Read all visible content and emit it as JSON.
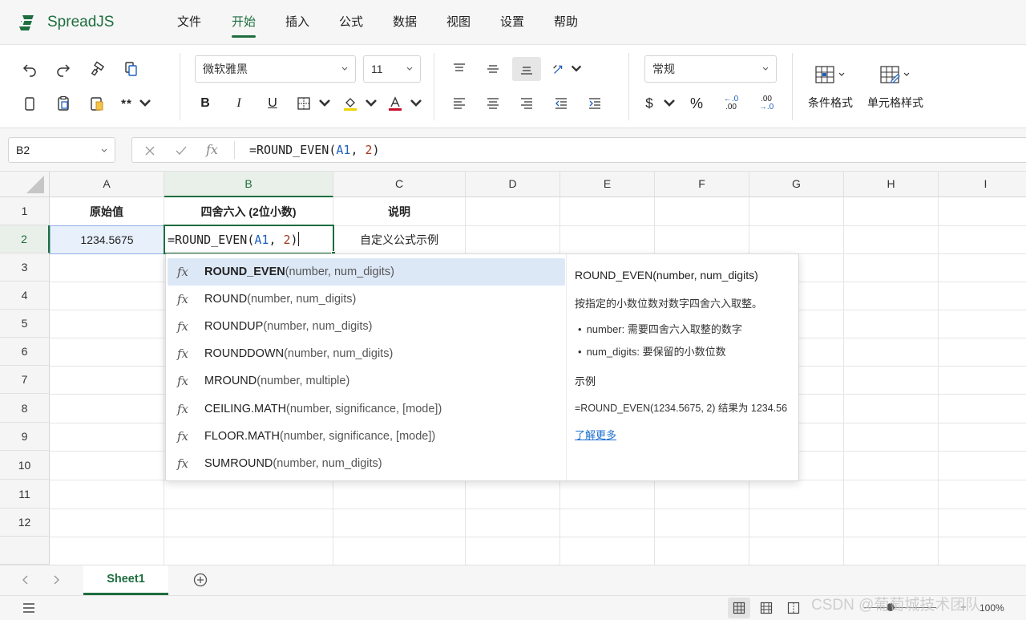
{
  "app": {
    "name": "SpreadJS",
    "logo_icon": "spreadjs-logo-icon",
    "brand_color": "#1e6e3f"
  },
  "menu": [
    {
      "label": "文件"
    },
    {
      "label": "开始",
      "active": true
    },
    {
      "label": "插入"
    },
    {
      "label": "公式"
    },
    {
      "label": "数据"
    },
    {
      "label": "视图"
    },
    {
      "label": "设置"
    },
    {
      "label": "帮助"
    }
  ],
  "ribbon": {
    "font_name": "微软雅黑",
    "font_size": "11",
    "number_format": "常规",
    "bold": "B",
    "italic": "I",
    "underline": "U",
    "currency": "$",
    "percent": "%",
    "inc_decimal_top": "←.0",
    "inc_decimal_bottom": ".00",
    "dec_decimal_top": ".00",
    "dec_decimal_bottom": "→.0",
    "conditional_format": "条件格式",
    "cell_styles": "单元格样式",
    "format_painter_icon": "format-painter-icon"
  },
  "formula_bar": {
    "cell_ref": "B2",
    "fx_label": "fx",
    "prefix": "=ROUND_EVEN(",
    "ref": "A1",
    "sep": ", ",
    "num": "2",
    "suffix": ")"
  },
  "columns": [
    "A",
    "B",
    "C",
    "D",
    "E",
    "F",
    "G",
    "H",
    "I"
  ],
  "rows": [
    "1",
    "2",
    "3",
    "4",
    "5",
    "6",
    "7",
    "8",
    "9",
    "10",
    "11",
    "12"
  ],
  "cells": {
    "A1": "原始值",
    "B1": "四舍六入 (2位小数)",
    "C1": "说明",
    "A2": "1234.5675",
    "C2": "自定义公式示例"
  },
  "editor": {
    "prefix": "=ROUND_EVEN(",
    "ref": "A1",
    "sep": ", ",
    "num": "2",
    "suffix": ")"
  },
  "autocomplete": {
    "items": [
      {
        "name": "ROUND_EVEN",
        "args": "(number, num_digits)",
        "selected": true
      },
      {
        "name": "ROUND",
        "args": "(number, num_digits)"
      },
      {
        "name": "ROUNDUP",
        "args": "(number, num_digits)"
      },
      {
        "name": "ROUNDDOWN",
        "args": "(number, num_digits)"
      },
      {
        "name": "MROUND",
        "args": "(number, multiple)"
      },
      {
        "name": "CEILING.MATH",
        "args": "(number, significance, [mode])"
      },
      {
        "name": "FLOOR.MATH",
        "args": "(number, significance, [mode])"
      },
      {
        "name": "SUMROUND",
        "args": "(number, num_digits)"
      }
    ],
    "fx_label": "fx",
    "detail": {
      "signature": "ROUND_EVEN(number, num_digits)",
      "description": "按指定的小数位数对数字四舍六入取整。",
      "params": [
        "number: 需要四舍六入取整的数字",
        "num_digits: 要保留的小数位数"
      ],
      "example_title": "示例",
      "example": "=ROUND_EVEN(1234.5675, 2) 结果为 1234.56",
      "learn_more": "了解更多"
    }
  },
  "sheets": [
    {
      "name": "Sheet1",
      "active": true
    }
  ],
  "status": {
    "zoom": "100%"
  },
  "watermark": "CSDN @葡萄城技术团队"
}
